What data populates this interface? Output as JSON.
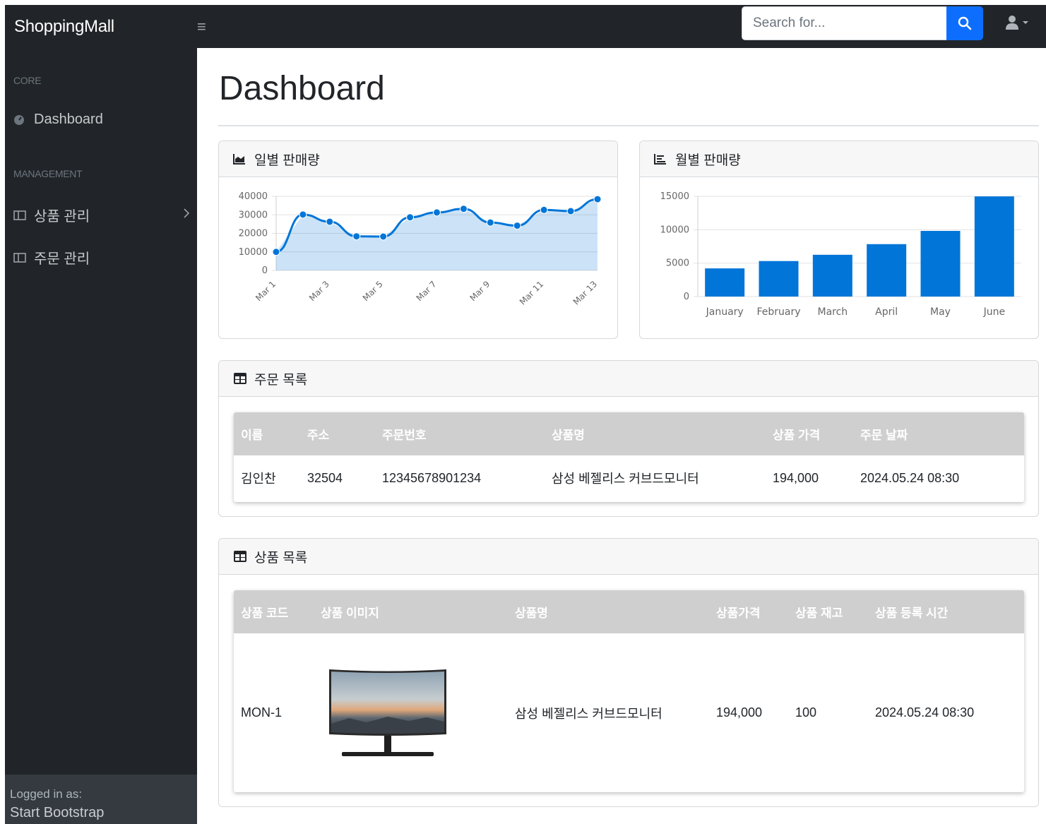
{
  "brand": "ShoppingMall",
  "search": {
    "placeholder": "Search for..."
  },
  "sidebar": {
    "core_heading": "CORE",
    "dashboard_label": "Dashboard",
    "management_heading": "MANAGEMENT",
    "items": [
      {
        "label": "상품 관리"
      },
      {
        "label": "주문 관리"
      }
    ],
    "footer_small": "Logged in as:",
    "footer_name": "Start Bootstrap"
  },
  "page": {
    "title": "Dashboard"
  },
  "daily_card": {
    "title": "일별 판매량"
  },
  "monthly_card": {
    "title": "월별 판매량"
  },
  "chart_data": [
    {
      "type": "area",
      "x": [
        "Mar 1",
        "Mar 2",
        "Mar 3",
        "Mar 4",
        "Mar 5",
        "Mar 6",
        "Mar 7",
        "Mar 8",
        "Mar 9",
        "Mar 10",
        "Mar 11",
        "Mar 12",
        "Mar 13"
      ],
      "tick_labels": [
        "Mar 1",
        "Mar 3",
        "Mar 5",
        "Mar 7",
        "Mar 9",
        "Mar 11",
        "Mar 13"
      ],
      "values": [
        10000,
        30162,
        26263,
        18394,
        18287,
        28682,
        31274,
        33259,
        25849,
        24159,
        32651,
        31984,
        38451
      ],
      "yticks": [
        0,
        10000,
        20000,
        30000,
        40000
      ],
      "ylim": [
        0,
        40000
      ],
      "grid": true,
      "color": "#0275d8",
      "fill": "rgba(2,117,216,0.2)"
    },
    {
      "type": "bar",
      "categories": [
        "January",
        "February",
        "March",
        "April",
        "May",
        "June"
      ],
      "values": [
        4215,
        5312,
        6251,
        7841,
        9821,
        14984
      ],
      "yticks": [
        0,
        5000,
        10000,
        15000
      ],
      "ylim": [
        0,
        15000
      ],
      "grid": true,
      "color": "#0275d8"
    }
  ],
  "orders": {
    "title": "주문 목록",
    "columns": [
      "이름",
      "주소",
      "주문번호",
      "상품명",
      "상품 가격",
      "주문 날짜"
    ],
    "rows": [
      [
        "김인찬",
        "32504",
        "12345678901234",
        "삼성 베젤리스 커브드모니터",
        "194,000",
        "2024.05.24 08:30"
      ]
    ]
  },
  "products": {
    "title": "상품 목록",
    "columns": [
      "상품 코드",
      "상품 이미지",
      "상품명",
      "상품가격",
      "상품 재고",
      "상품 등록 시간"
    ],
    "rows": [
      [
        "MON-1",
        "",
        "삼성 베젤리스 커브드모니터",
        "194,000",
        "100",
        "2024.05.24 08:30"
      ]
    ]
  }
}
